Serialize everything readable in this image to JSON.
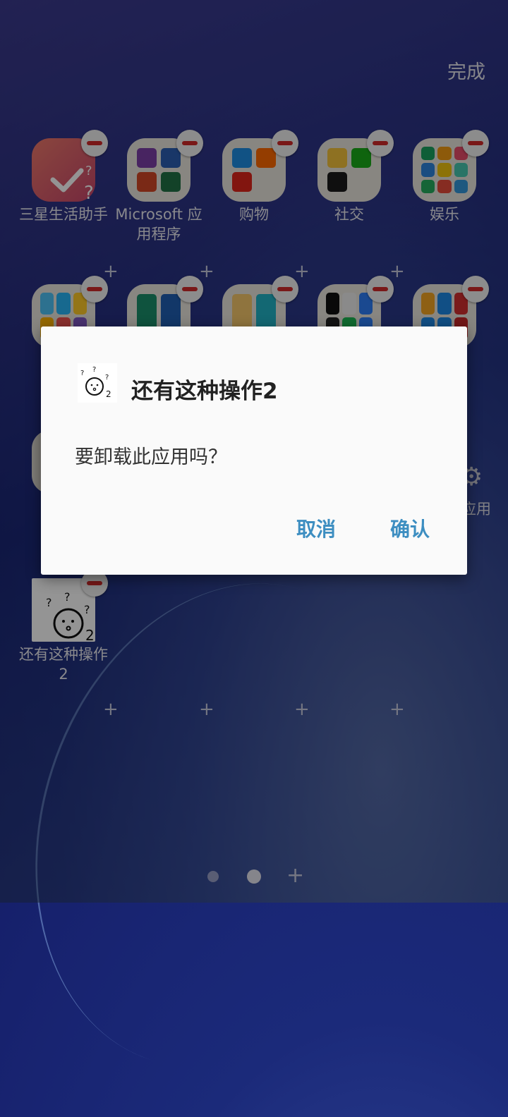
{
  "header": {
    "done_label": "完成"
  },
  "apps_row1": [
    {
      "label": "三星生活助手"
    },
    {
      "label": "Microsoft 应用程序"
    },
    {
      "label": "购物"
    },
    {
      "label": "社交"
    },
    {
      "label": "娱乐"
    }
  ],
  "partial_label": "应用",
  "bottom_app": {
    "label": "还有这种操作2"
  },
  "dialog": {
    "title": "还有这种操作2",
    "message": "要卸载此应用吗？",
    "cancel_label": "取消",
    "confirm_label": "确认",
    "icon_text": "2"
  },
  "colors": {
    "accent": "#3d8ec1",
    "minus_red": "#d02a2a"
  }
}
